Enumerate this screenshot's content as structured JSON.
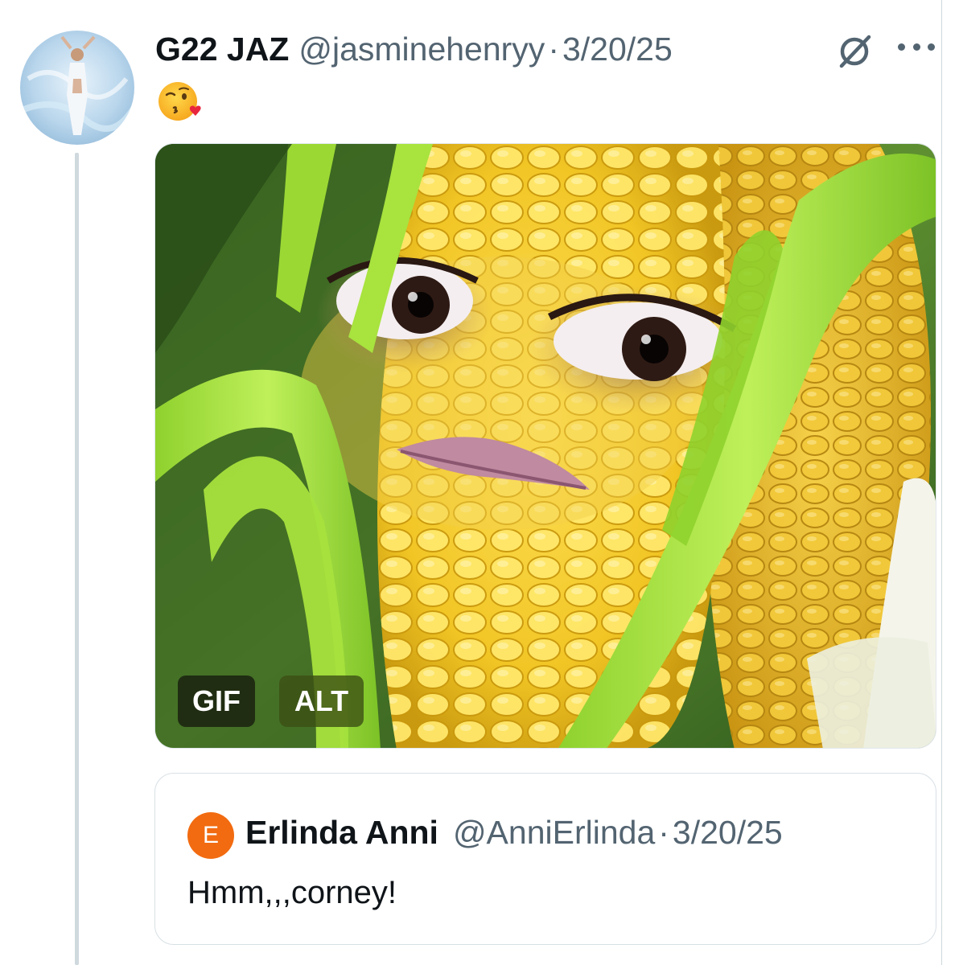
{
  "tweet": {
    "display_name": "G22 JAZ",
    "handle": "@jasminehenryy",
    "separator": "·",
    "date": "3/20/25",
    "text_emoji": "face-blowing-a-kiss-emoji",
    "grok_icon": "slashed-circle-icon",
    "more_icon": "more-dots-icon",
    "media": {
      "kind": "animated corn-cob face GIF",
      "badges": {
        "gif_label": "GIF",
        "alt_label": "ALT"
      }
    }
  },
  "quoted_tweet": {
    "avatar_letter": "E",
    "avatar_color": "#f26b10",
    "display_name": "Erlinda Anni",
    "handle": "@AnniErlinda",
    "separator": "·",
    "date": "3/20/25",
    "text": "Hmm,,,corney!"
  },
  "colors": {
    "primary_text": "#0f1419",
    "secondary_text": "#536471",
    "thread_line": "#cfd9de",
    "border": "#d8e0e5"
  }
}
